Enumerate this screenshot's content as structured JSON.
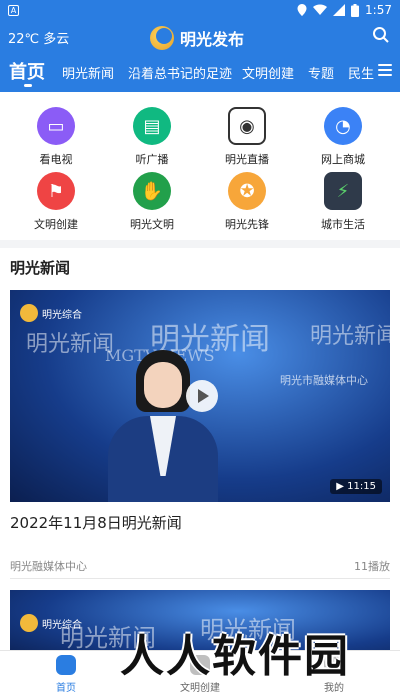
{
  "status_bar": {
    "time": "1:57",
    "left_icon": "A",
    "right_icons": [
      "location-icon",
      "wifi-icon",
      "signal-icon",
      "battery-icon"
    ]
  },
  "header": {
    "weather": "22℃ 多云",
    "app_title": "明光发布"
  },
  "tabs": [
    "首页",
    "明光新闻",
    "沿着总书记的足迹",
    "文明创建",
    "专题",
    "民生"
  ],
  "grid": [
    {
      "label": "看电视",
      "color": "#8b5cf6",
      "icon": "tv-icon"
    },
    {
      "label": "听广播",
      "color": "#10b981",
      "icon": "radio-icon"
    },
    {
      "label": "明光直播",
      "color": "#ffffff",
      "icon": "camera-icon"
    },
    {
      "label": "网上商城",
      "color": "#3b82f6",
      "icon": "chat-icon"
    },
    {
      "label": "文明创建",
      "color": "#ef4444",
      "icon": "flag-icon"
    },
    {
      "label": "明光文明",
      "color": "#22a04b",
      "icon": "hands-icon"
    },
    {
      "label": "明光先锋",
      "color": "#f7a63a",
      "icon": "badge-icon"
    },
    {
      "label": "城市生活",
      "color": "#2f3a4a",
      "icon": "charging-icon"
    }
  ],
  "section_title": "明光新闻",
  "video": {
    "channel": "明光综合",
    "overlay_text_1": "明光新闻",
    "overlay_text_2": "MGTV NEWS",
    "overlay_text_3": "明光市融媒体中心",
    "duration": "11:15"
  },
  "news_item": {
    "title": "2022年11月8日明光新闻",
    "source": "明光融媒体中心",
    "views": "11播放"
  },
  "video2": {
    "channel": "明光综合",
    "overlay_text": "明光新闻"
  },
  "bottom_nav": [
    {
      "label": "首页",
      "active": true
    },
    {
      "label": "文明创建",
      "active": false
    },
    {
      "label": "我的",
      "active": false
    }
  ],
  "watermark": "人人软件园",
  "colors": {
    "brand_blue": "#2a7de1"
  }
}
